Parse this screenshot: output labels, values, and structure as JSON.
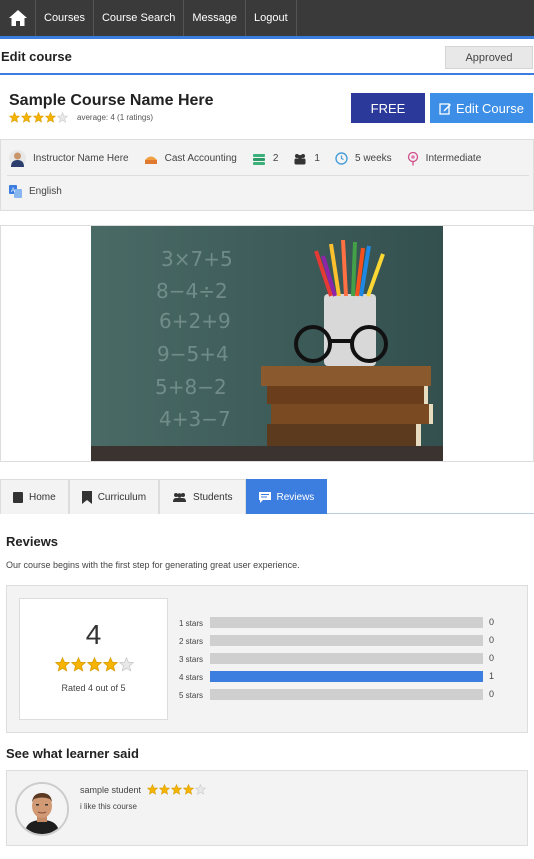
{
  "nav": {
    "items": [
      "Courses",
      "Course Search",
      "Message",
      "Logout"
    ],
    "accent": "#3c7de0"
  },
  "editbar": {
    "title": "Edit course",
    "status": "Approved"
  },
  "course": {
    "title": "Sample Course Name Here",
    "rating_value": 4,
    "rating_text": "average: 4 (1 ratings)",
    "price_label": "FREE",
    "edit_label": "Edit Course"
  },
  "info": {
    "instructor": "Instructor Name Here",
    "category": "Cast Accounting",
    "lessons": "2",
    "students": "1",
    "duration": "5 weeks",
    "level": "Intermediate",
    "language": "English"
  },
  "tabs": [
    {
      "label": "Home",
      "icon": "home-icon"
    },
    {
      "label": "Curriculum",
      "icon": "bookmark-icon"
    },
    {
      "label": "Students",
      "icon": "users-icon"
    },
    {
      "label": "Reviews",
      "icon": "comment-icon",
      "active": true
    }
  ],
  "reviews": {
    "title": "Reviews",
    "description": "Our course begins with the first step for generating great user experience.",
    "score": "4",
    "score_text": "Rated 4 out of 5",
    "breakdown": [
      {
        "label": "1 stars",
        "count": "0",
        "fraction": 0
      },
      {
        "label": "2 stars",
        "count": "0",
        "fraction": 0
      },
      {
        "label": "3 stars",
        "count": "0",
        "fraction": 0
      },
      {
        "label": "4 stars",
        "count": "1",
        "fraction": 1
      },
      {
        "label": "5 stars",
        "count": "0",
        "fraction": 0
      }
    ]
  },
  "learner": {
    "title": "See what learner said",
    "name": "sample student",
    "rating_value": 4,
    "comment": "i like this course"
  }
}
